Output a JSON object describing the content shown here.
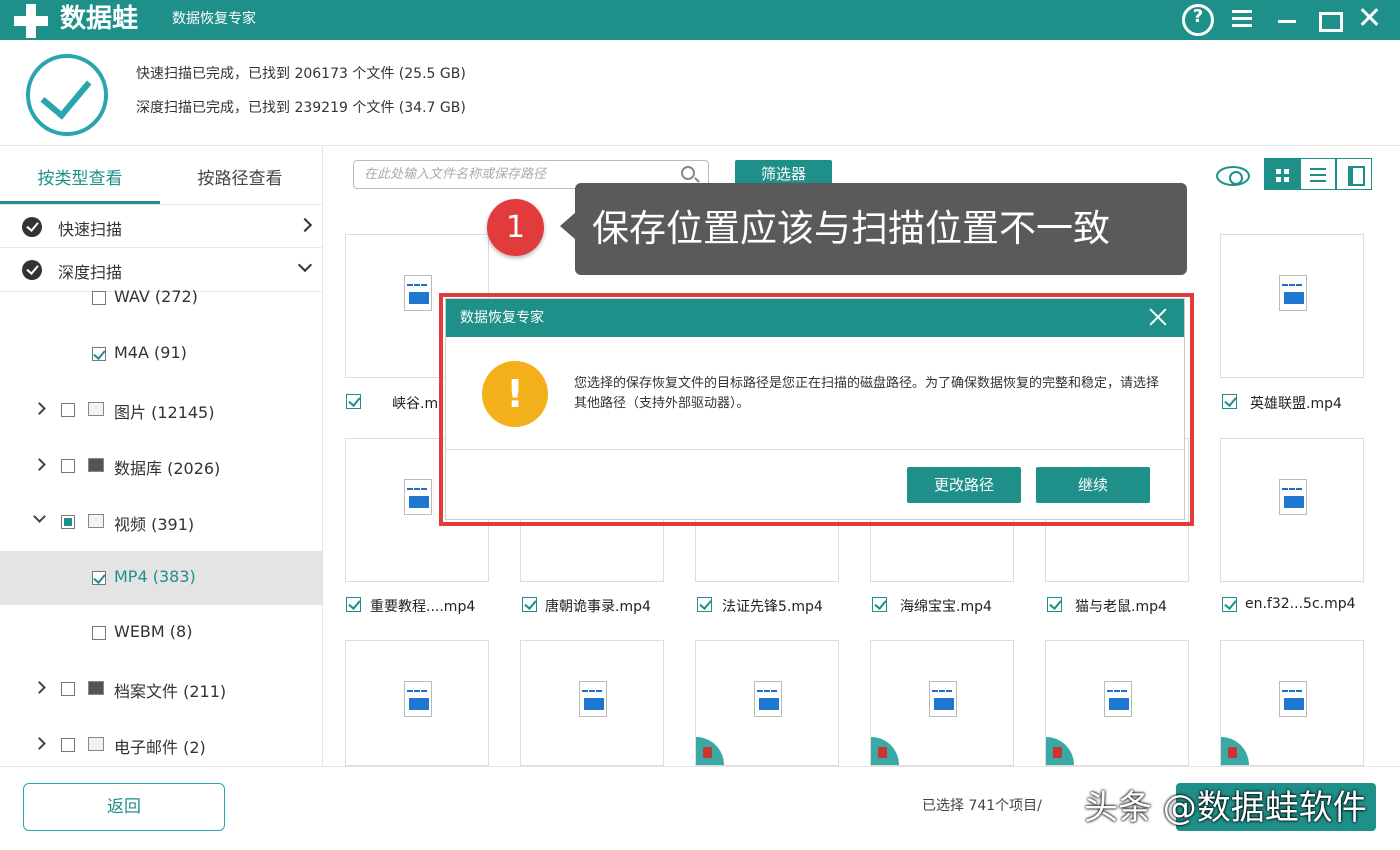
{
  "app": {
    "name": "数据蛙",
    "subtitle": "数据恢复专家"
  },
  "summary": {
    "quick": "快速扫描已完成，已找到 206173 个文件 (25.5 GB)",
    "deep": "深度扫描已完成，已找到 239219 个文件 (34.7 GB)"
  },
  "sidebar": {
    "tabs": [
      "按类型查看",
      "按路径查看"
    ],
    "scans": [
      "快速扫描",
      "深度扫描"
    ],
    "tree": [
      {
        "label": "WAV (272)",
        "checked": "off"
      },
      {
        "label": "M4A (91)",
        "checked": "on"
      },
      {
        "label": "图片 (12145)",
        "checked": "off"
      },
      {
        "label": "数据库 (2026)",
        "checked": "off"
      },
      {
        "label": "视频 (391)",
        "checked": "partial"
      },
      {
        "label": "MP4 (383)",
        "checked": "on"
      },
      {
        "label": "WEBM (8)",
        "checked": "off"
      },
      {
        "label": "档案文件 (211)",
        "checked": "off"
      },
      {
        "label": "电子邮件 (2)",
        "checked": "off"
      }
    ]
  },
  "toolbar": {
    "search_placeholder": "在此处输入文件名称或保存路径",
    "filter_label": "筛选器"
  },
  "files": {
    "row1": [
      "峡谷.m",
      "英雄联盟.mp4"
    ],
    "row2": [
      "重要教程....mp4",
      "唐朝诡事录.mp4",
      "法证先锋5.mp4",
      "海绵宝宝.mp4",
      "猫与老鼠.mp4",
      "en.f32...5c.mp4"
    ]
  },
  "callout": {
    "number": "1",
    "text": "保存位置应该与扫描位置不一致"
  },
  "dialog": {
    "title": "数据恢复专家",
    "message": "您选择的保存恢复文件的目标路径是您正在扫描的磁盘路径。为了确保数据恢复的完整和稳定，请选择其他路径（支持外部驱动器）。",
    "btn_change": "更改路径",
    "btn_continue": "继续"
  },
  "footer": {
    "back": "返回",
    "selected": "已选择 741个项目/",
    "watermark": "头条 @数据蛙软件"
  }
}
